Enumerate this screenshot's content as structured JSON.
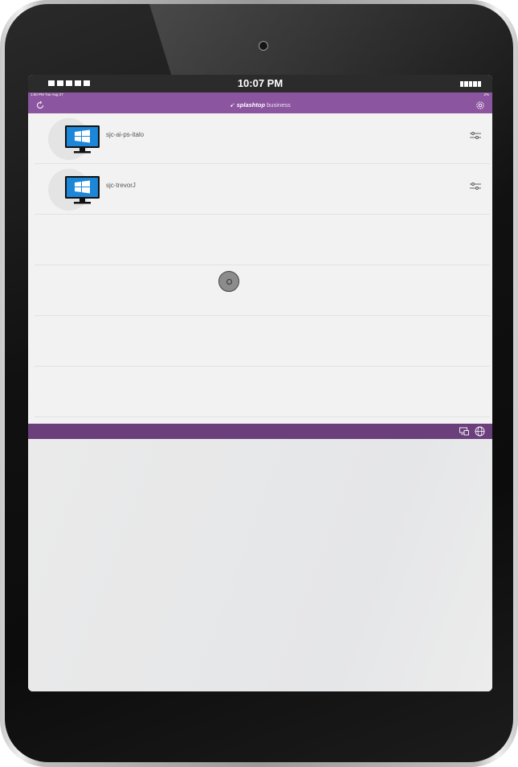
{
  "device": {
    "status_time": "10:07 PM"
  },
  "app": {
    "status": {
      "time": "1:50 PM  Tue Aug 27",
      "battery": "2%"
    },
    "header": {
      "logo_bold": "splashtop",
      "logo_light": "business",
      "refresh_icon": "refresh-icon",
      "settings_icon": "gear-icon"
    },
    "computers": [
      {
        "name": "sjc-ai-ps-italo",
        "icon": "windows-computer-icon"
      },
      {
        "name": "sjc-trevorJ",
        "icon": "windows-computer-icon"
      }
    ],
    "toolbar": {
      "left_icon": "remote-desktop-icon",
      "right_icon": "web-globe-icon"
    },
    "colors": {
      "header": "#8c55a0",
      "toolbar": "#6a3f7c",
      "list_bg": "#f2f2f2"
    }
  }
}
